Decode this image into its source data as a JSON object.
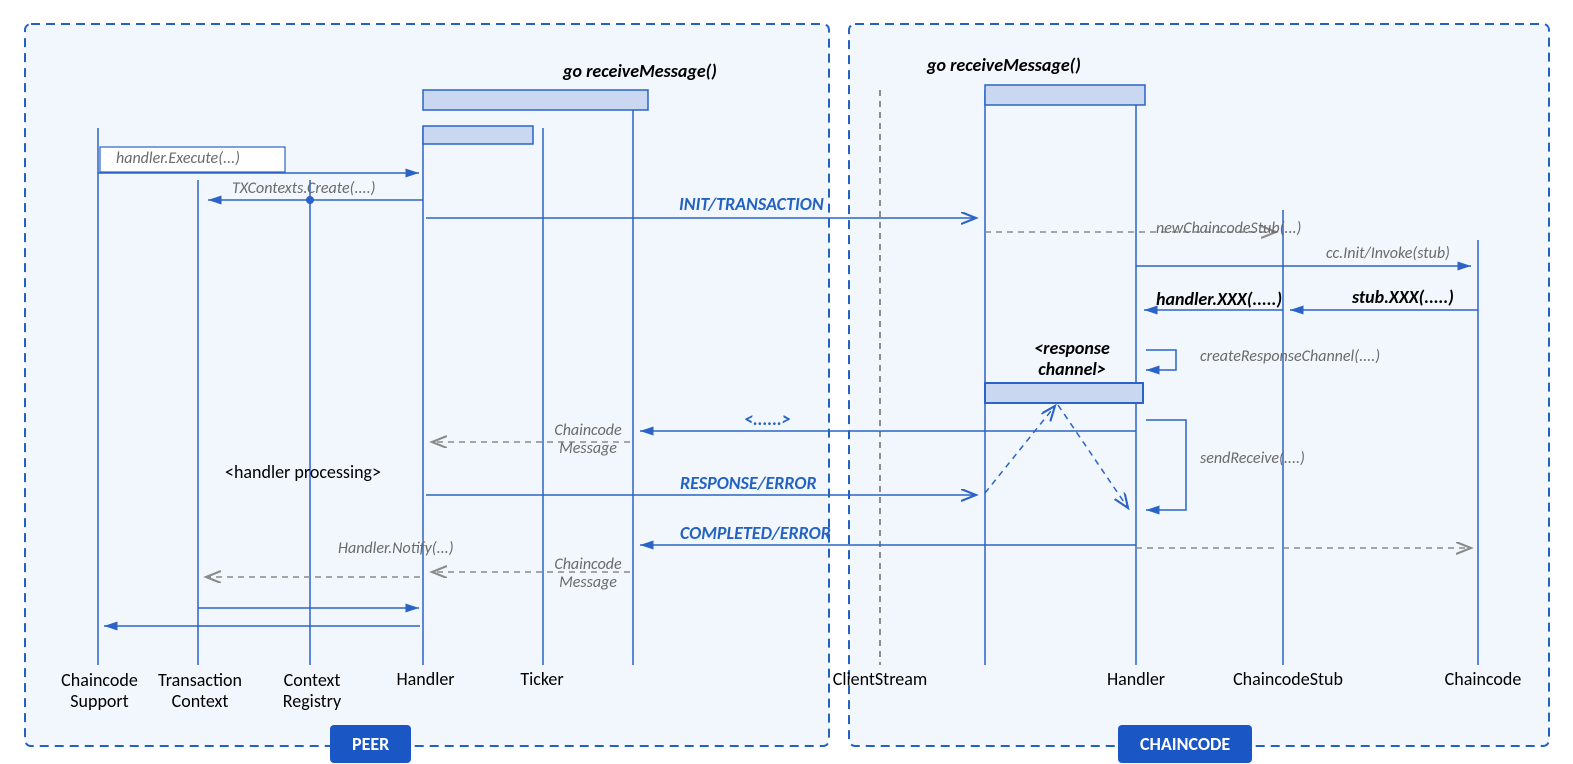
{
  "colors": {
    "boxBorder": "#2462c2",
    "boxFill": "#eaf1fb",
    "lifeline": "#2b63c7",
    "dashed": "#2b63c7",
    "activation": "#c9d8f0",
    "activationDark": "#2b63c7",
    "blueText": "#2462c2",
    "grayText": "#6a6a6a"
  },
  "badges": {
    "peer": "PEER",
    "cc": "CHAINCODE"
  },
  "lifelines": {
    "cs": "Chaincode\nSupport",
    "tc": "Transaction\nContext",
    "cr": "Context\nRegistry",
    "handler": "Handler",
    "ticker": "Ticker",
    "clientstream": "ClientStream",
    "handler2": "Handler",
    "stub": "ChaincodeStub",
    "chaincode": "Chaincode"
  },
  "notes": {
    "goRecv1": "go receiveMessage()",
    "goRecv2": "go receiveMessage()",
    "handlerExec": "handler.Execute(...)",
    "txCreate": "TXContexts.Create(....)",
    "initTx": "INIT/TRANSACTION",
    "newStub": "newChaincodeStub(...)",
    "ccInit": "cc.Init/Invoke(stub)",
    "handlerXXX": "handler.XXX(.....)",
    "stubXXX": "stub.XXX(.....)",
    "respChan": "<response\nchannel>",
    "createResp": "createResponseChannel(....)",
    "dots": "<......>",
    "ccMsg1": "Chaincode\nMessage",
    "sendRecv": "sendReceive(....)",
    "respError": "RESPONSE/ERROR",
    "handlerProc": "<handler processing>",
    "completed": "COMPLETED/ERROR",
    "handlerNotify": "Handler.Notify(...)",
    "ccMsg2": "Chaincode\nMessage"
  }
}
